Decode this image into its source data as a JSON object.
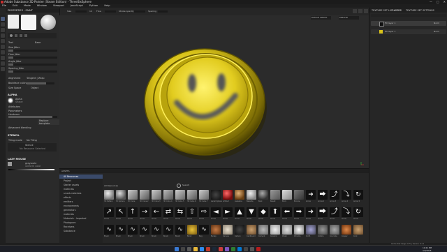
{
  "titlebar": {
    "title": "Adobe Substance 3D Painter (Steam Edition) - ThreeSixSphere"
  },
  "menubar": [
    "File",
    "Edit",
    "Mode",
    "Window",
    "Viewport",
    "JavaScript",
    "Python",
    "Help"
  ],
  "toolbar": {
    "size_label": "Size",
    "size_value": "10",
    "flow_label": "Flow",
    "stroke_label": "Stroke opacity",
    "spacing_label": "Spacing"
  },
  "properties": {
    "title": "PROPERTIES - PAINT",
    "tab_tool": "Tool",
    "tab_base": "Base",
    "size_label": "Size Jitter",
    "flow_label": "Flow Jitter",
    "angle_label": "Angle Jitter",
    "spacing_label": "Spacing Jitter",
    "alignment_label": "Alignment",
    "alignment_value": "Tangent | Wrap",
    "backface_label": "Backface culling",
    "sizespace_label": "Size Space",
    "sizespace_value": "Object",
    "alpha_title": "ALPHA",
    "alpha_name": "Alpha",
    "alpha_sub": "Shape",
    "attributes_label": "Attributes",
    "parameters_label": "Parameters",
    "hardness_label": "Hardness",
    "replace_label": "Replace template",
    "advanced_label": "Advanced blending",
    "stencil_title": "STENCIL",
    "stencil_mode_label": "Tiling mode",
    "stencil_mode_value": "No Tiling",
    "stencil_sub": "Stencil",
    "stencil_hint": "No Resource Selected",
    "lazy_title": "LAZY MOUSE",
    "lazy_name": "grayscale",
    "lazy_sub": "uniform color"
  },
  "viewport": {
    "material_dropdown": "Default Lateral",
    "mode_dropdown": "Material"
  },
  "rightpanel": {
    "tab1": "TEXTURE SET LIST",
    "tab2": "LAYERS",
    "tab3": "TEXTURE SET SETTINGS",
    "layer1": "Fill layer 1",
    "layer2": "Fill layer 1",
    "blend1": "Norm",
    "blend2": "Norm",
    "opacity1": "100"
  },
  "assets": {
    "title": "ASSETS",
    "search_placeholder": "Search",
    "filter_label": "All Resources",
    "tree": [
      "All Resources",
      "Project",
      "Starter assets",
      "materials",
      "smart-materials",
      "effects",
      "emitters",
      "environments",
      "generators",
      "materials",
      "Materials - Imported",
      "Photogram",
      "Receivers",
      "Substance"
    ],
    "row1_labels": [
      "3D Pattern",
      "3D Sphere",
      "3D Cube",
      "3D Cube 2",
      "3D Cube 3",
      "3D Cube 4",
      "3D Cube 5",
      "3D Cube 6",
      "3D Cube 7",
      "Aerial Sphere",
      "Artifact",
      "Asbestos",
      "Bakelite",
      "Bark",
      "Basalt",
      "Brick",
      "Bronze",
      "Arrow",
      "Arrow 2",
      "Arrow 3",
      "Arrow 4",
      "Arrow 5"
    ],
    "row2_labels": [
      "Arrow",
      "Arrow",
      "Arrow",
      "Arrow",
      "Arrow",
      "Arrow",
      "Arrow",
      "Arrow",
      "Arrow",
      "Arrow",
      "Arrow",
      "Arrow",
      "Arrow",
      "Arrow",
      "Arrow",
      "Arrow",
      "Arrow",
      "Arrow",
      "Arrow",
      "Arrow",
      "Arrow",
      "Arrow"
    ],
    "row3_labels": [
      "Brush",
      "Brush",
      "Brush",
      "Brush",
      "Brush",
      "Brush",
      "Brush",
      "Burst",
      "Bug",
      "Burlap",
      "Canvas",
      "Carbon",
      "Cardboard",
      "Cement",
      "Ceramic",
      "Chalk",
      "Chrome",
      "Cloth",
      "Cobble",
      "Concrete",
      "Copper",
      "Cork"
    ]
  },
  "statusbar": {
    "text": "Cache Disk Usage: 13% | Version: 9.1.1"
  },
  "taskbar": {
    "time": "10:21 PM",
    "date": "2/9/2025"
  },
  "colors": {
    "accent_yellow": "#d8c219",
    "viewport_bg": "#2b2b2b",
    "panel_bg": "#2a2a2a",
    "selection_blue": "#3a4a6a"
  }
}
